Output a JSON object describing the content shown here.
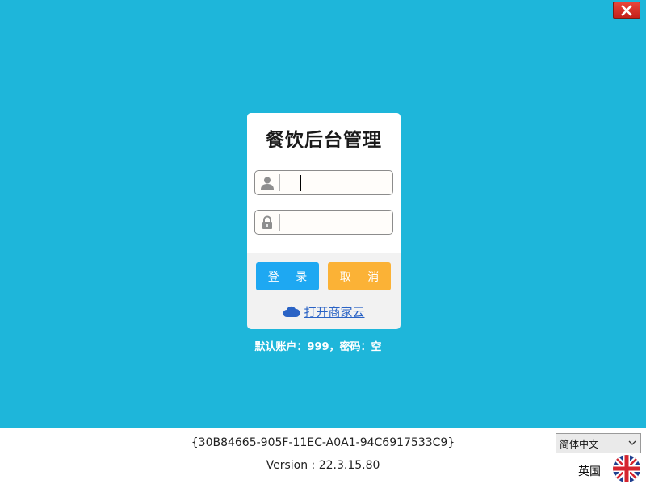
{
  "window": {
    "close_icon": "close-x-icon",
    "background_color": "#1eb6da"
  },
  "login": {
    "title": "餐饮后台管理",
    "username": {
      "icon": "user-icon",
      "value": "",
      "placeholder": ""
    },
    "password": {
      "icon": "lock-icon",
      "value": "",
      "placeholder": ""
    },
    "login_button": "登 录",
    "cancel_button": "取 消",
    "cloud_link": {
      "icon": "cloud-icon",
      "label": "打开商家云"
    },
    "colors": {
      "login": "#1ea8f2",
      "cancel": "#fbb236",
      "link": "#2a63c5"
    }
  },
  "hint": "默认账户：999，密码：空",
  "footer": {
    "guid": "{30B84665-905F-11EC-A0A1-94C6917533C9}",
    "version": "Version : 22.3.15.80",
    "language_select": {
      "value": "简体中文",
      "icon": "chevron-down-icon"
    },
    "flag_label": "英国",
    "flag_icon": "uk-flag-icon"
  }
}
